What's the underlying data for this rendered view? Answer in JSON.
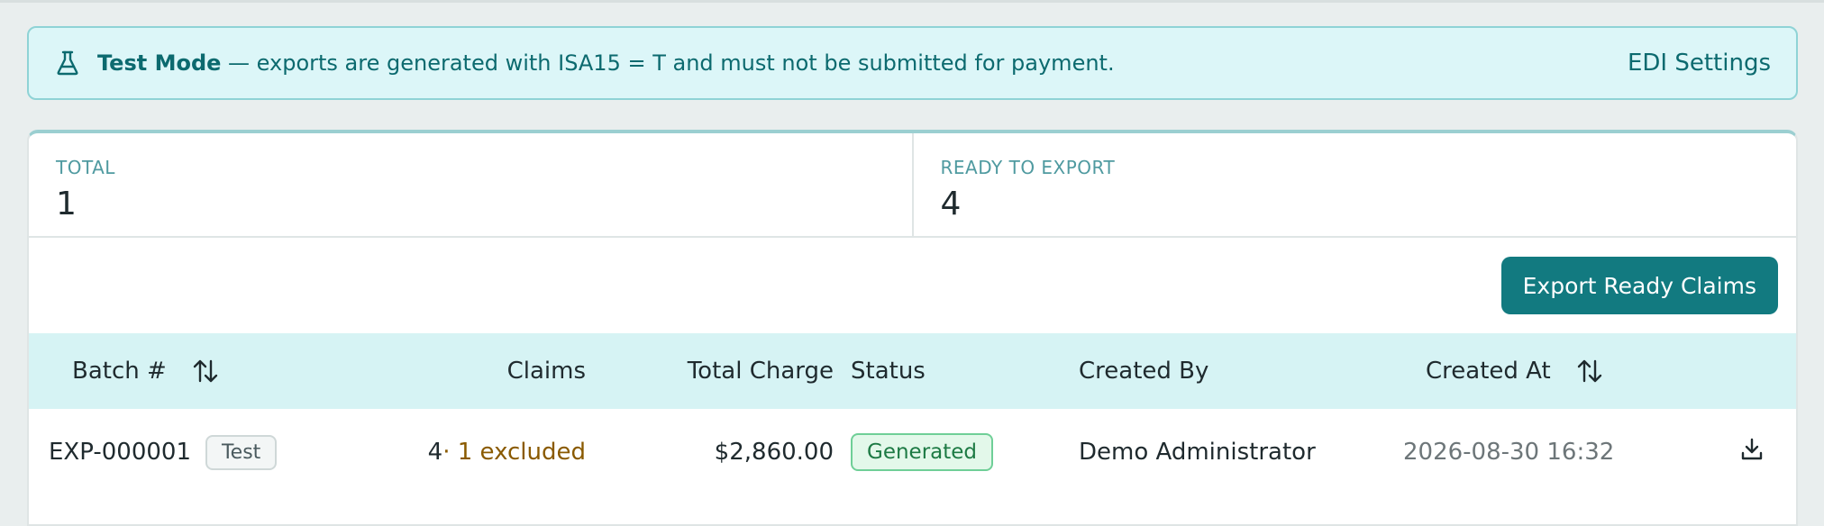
{
  "banner": {
    "title": "Test Mode",
    "message": " — exports are generated with ISA15 = T and must not be submitted for payment.",
    "settings_link": "EDI Settings"
  },
  "stats": [
    {
      "label": "TOTAL",
      "value": "1"
    },
    {
      "label": "READY TO EXPORT",
      "value": "4"
    }
  ],
  "actions": {
    "export_label": "Export Ready Claims"
  },
  "table": {
    "columns": {
      "batch": "Batch #",
      "claims": "Claims",
      "total_charge": "Total Charge",
      "status": "Status",
      "created_by": "Created By",
      "created_at": "Created At"
    },
    "rows": [
      {
        "batch": "EXP-000001",
        "tag": "Test",
        "claims": "4",
        "excluded": " · 1 excluded",
        "total_charge": "$2,860.00",
        "status": "Generated",
        "created_by": "Demo Administrator",
        "created_at": "2026-08-30 16:32"
      }
    ]
  },
  "colors": {
    "accent": "#127a80",
    "banner_bg": "#dcf6f8",
    "header_bg": "#d6f3f4",
    "status_generated": "#1d7a44",
    "excluded": "#8a5a00"
  },
  "icons": {
    "banner": "flask-icon",
    "sort": "sort-arrows-icon",
    "row_action": "download-icon"
  }
}
